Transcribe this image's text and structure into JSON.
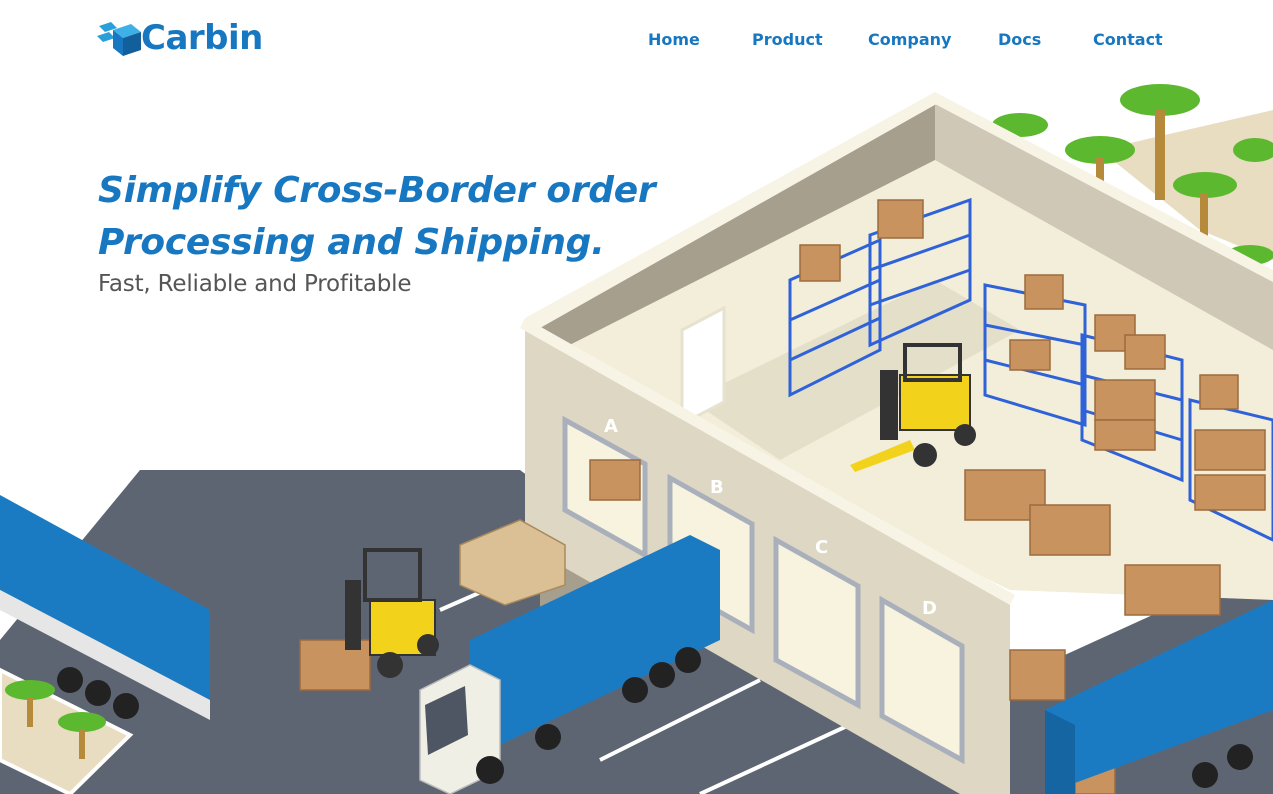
{
  "brand": {
    "name": "Carbin",
    "primary_color": "#1777c0"
  },
  "nav": {
    "items": [
      {
        "label": "Home"
      },
      {
        "label": "Product"
      },
      {
        "label": "Company"
      },
      {
        "label": "Docs"
      },
      {
        "label": "Contact"
      }
    ]
  },
  "hero": {
    "title_line1": "Simplify Cross-Border order",
    "title_line2": "Processing and Shipping.",
    "subtitle": "Fast, Reliable and Profitable"
  },
  "illustration": {
    "dock_labels": [
      "A",
      "B",
      "C",
      "D"
    ]
  }
}
